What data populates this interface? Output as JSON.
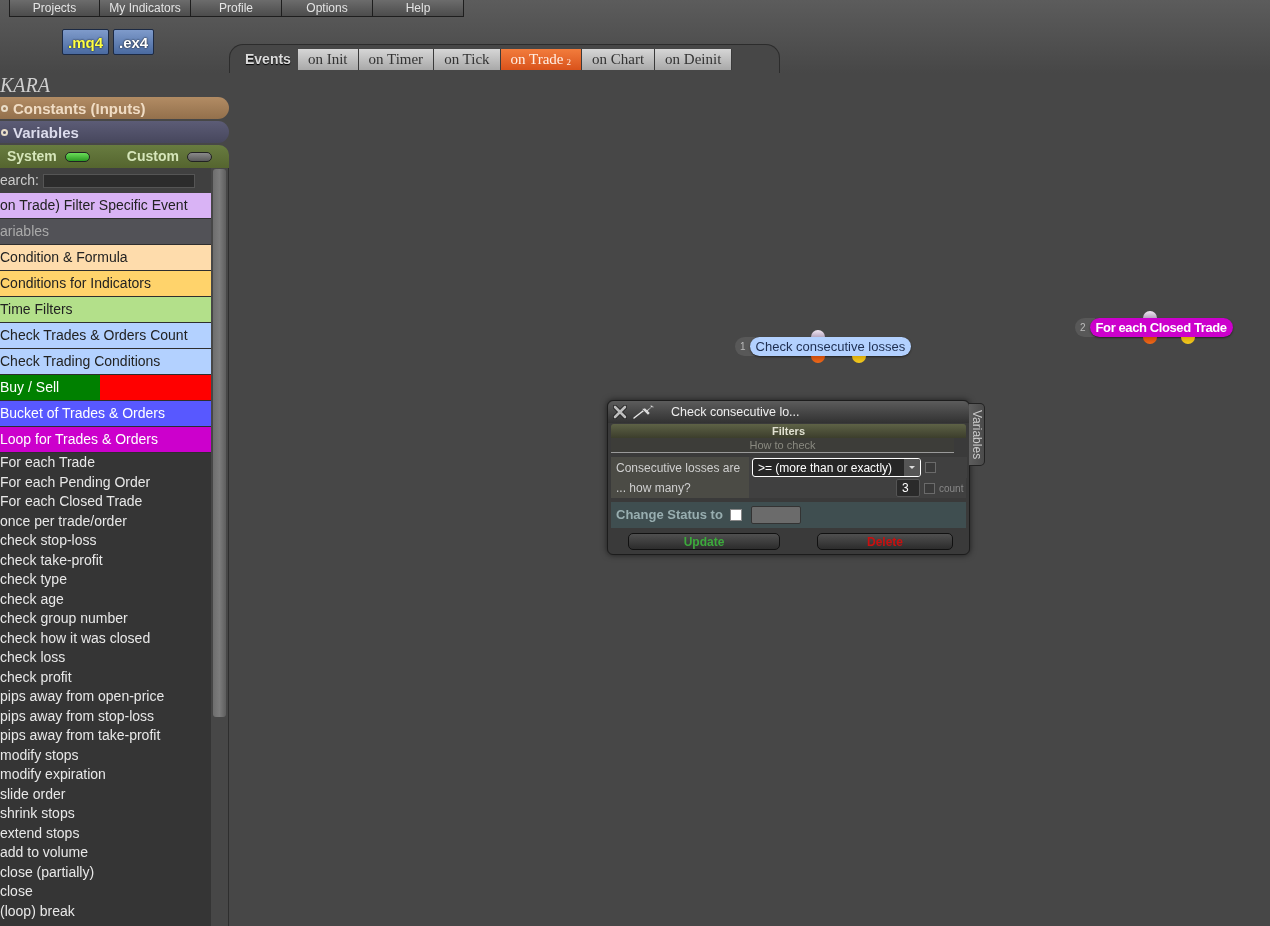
{
  "menu_bar": {
    "items": [
      "Projects",
      "My Indicators",
      "Profile",
      "Options",
      "Help"
    ]
  },
  "file_buttons": [
    {
      "label": ".mq4",
      "kind": "source"
    },
    {
      "label": ".ex4",
      "kind": "compiled"
    }
  ],
  "event_tabs": {
    "label": "Events",
    "tabs": [
      {
        "label": "on Init",
        "selected": false
      },
      {
        "label": "on Timer",
        "selected": false
      },
      {
        "label": "on Tick",
        "selected": false
      },
      {
        "label": "on Trade",
        "badge": "2",
        "selected": true
      },
      {
        "label": "on Chart",
        "selected": false
      },
      {
        "label": "on Deinit",
        "selected": false
      }
    ]
  },
  "sidebar": {
    "project_name": "KARA",
    "sections": [
      {
        "label": "Constants (Inputs)",
        "kind": "constants"
      },
      {
        "label": "Variables",
        "kind": "variables"
      }
    ],
    "filter_toggles": [
      {
        "label": "System",
        "on": true
      },
      {
        "label": "Custom",
        "on": false
      }
    ],
    "search": {
      "label": "earch:"
    },
    "categories": [
      {
        "label": "on Trade) Filter Specific Event",
        "kind": "category",
        "color": "#d9b3f5"
      },
      {
        "label": "ariables",
        "kind": "header"
      },
      {
        "label": "Condition & Formula",
        "kind": "category",
        "color": "#fedcac"
      },
      {
        "label": "Conditions for Indicators",
        "kind": "category",
        "color": "#ffd36b"
      },
      {
        "label": "Time Filters",
        "kind": "category",
        "color": "#b3e08a"
      },
      {
        "label": "Check Trades & Orders Count",
        "kind": "category",
        "color": "#b3d1ff"
      },
      {
        "label": "Check Trading Conditions",
        "kind": "category",
        "color": "#b3d1ff"
      },
      {
        "label": "Buy / Sell",
        "kind": "split",
        "segments": [
          {
            "color": "#008000"
          },
          {
            "color": "#ff0000"
          }
        ]
      },
      {
        "label": "Bucket of Trades & Orders",
        "kind": "category",
        "color": "#5858ff"
      },
      {
        "label": "Loop for Trades & Orders",
        "kind": "category",
        "color": "#cc00cc",
        "children": [
          {
            "label": "For each Trade"
          },
          {
            "label": "For each Pending Order"
          },
          {
            "label": "For each Closed Trade"
          },
          {
            "label": "once per trade/order"
          },
          {
            "label": "check stop-loss"
          },
          {
            "label": "check take-profit"
          },
          {
            "label": "check type"
          },
          {
            "label": "check age"
          },
          {
            "label": "check group number"
          },
          {
            "label": "check how it was closed"
          },
          {
            "label": "check loss"
          },
          {
            "label": "check profit"
          },
          {
            "label": "pips away from open-price"
          },
          {
            "label": "pips away from stop-loss"
          },
          {
            "label": "pips away from take-profit"
          },
          {
            "label": "modify stops"
          },
          {
            "label": "modify expiration"
          },
          {
            "label": "slide order"
          },
          {
            "label": "shrink stops"
          },
          {
            "label": "extend stops"
          },
          {
            "label": "add to volume"
          },
          {
            "label": "close (partially)"
          },
          {
            "label": "close"
          },
          {
            "label": "(loop) break"
          }
        ]
      }
    ]
  },
  "canvas": {
    "blocks": [
      {
        "number": "1",
        "label": "Check consecutive losses",
        "color": "#b3d1ff"
      },
      {
        "number": "2",
        "label": "For each Closed Trade",
        "color": "#cc00cc"
      }
    ]
  },
  "dialog": {
    "title": "Check consecutive lo...",
    "side_tab": "Variables",
    "section": "Filters",
    "subsection": "How to check",
    "fields": [
      {
        "label": "Consecutive losses are",
        "kind": "select",
        "value": ">= (more than or exactly)",
        "checked": false
      },
      {
        "label": "... how many?",
        "kind": "number",
        "value": "3",
        "checked": false,
        "checkbox_label": "count"
      }
    ],
    "status": {
      "label": "Change Status to",
      "checked": false
    },
    "buttons": [
      {
        "label": "Update",
        "kind": "update"
      },
      {
        "label": "Delete",
        "kind": "delete"
      }
    ]
  }
}
